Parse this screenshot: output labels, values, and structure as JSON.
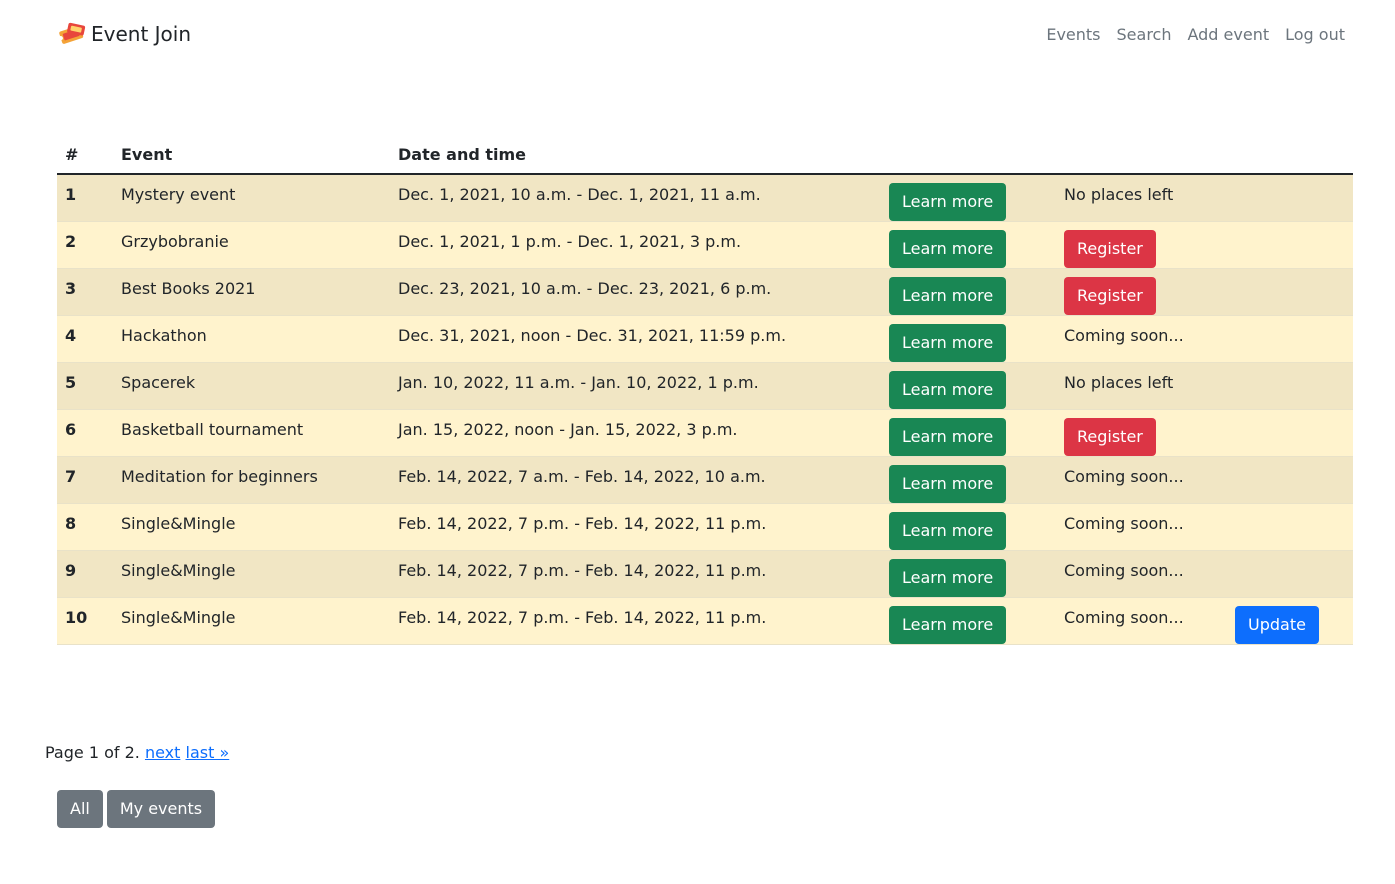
{
  "brand": {
    "name": "Event Join"
  },
  "nav": {
    "items": [
      {
        "label": "Events"
      },
      {
        "label": "Search"
      },
      {
        "label": "Add event"
      },
      {
        "label": "Log out"
      }
    ]
  },
  "table": {
    "headers": {
      "num": "#",
      "event": "Event",
      "date": "Date and time"
    },
    "rows": [
      {
        "num": "1",
        "event": "Mystery event",
        "date": "Dec. 1, 2021, 10 a.m. - Dec. 1, 2021, 11 a.m.",
        "learn": "Learn more",
        "status": "No places left",
        "status_type": "text",
        "extra": ""
      },
      {
        "num": "2",
        "event": "Grzybobranie",
        "date": "Dec. 1, 2021, 1 p.m. - Dec. 1, 2021, 3 p.m.",
        "learn": "Learn more",
        "status": "Register",
        "status_type": "button",
        "extra": ""
      },
      {
        "num": "3",
        "event": "Best Books 2021",
        "date": "Dec. 23, 2021, 10 a.m. - Dec. 23, 2021, 6 p.m.",
        "learn": "Learn more",
        "status": "Register",
        "status_type": "button",
        "extra": ""
      },
      {
        "num": "4",
        "event": "Hackathon",
        "date": "Dec. 31, 2021, noon - Dec. 31, 2021, 11:59 p.m.",
        "learn": "Learn more",
        "status": "Coming soon...",
        "status_type": "text",
        "extra": ""
      },
      {
        "num": "5",
        "event": "Spacerek",
        "date": "Jan. 10, 2022, 11 a.m. - Jan. 10, 2022, 1 p.m.",
        "learn": "Learn more",
        "status": "No places left",
        "status_type": "text",
        "extra": ""
      },
      {
        "num": "6",
        "event": "Basketball tournament",
        "date": "Jan. 15, 2022, noon - Jan. 15, 2022, 3 p.m.",
        "learn": "Learn more",
        "status": "Register",
        "status_type": "button",
        "extra": ""
      },
      {
        "num": "7",
        "event": "Meditation for beginners",
        "date": "Feb. 14, 2022, 7 a.m. - Feb. 14, 2022, 10 a.m.",
        "learn": "Learn more",
        "status": "Coming soon...",
        "status_type": "text",
        "extra": ""
      },
      {
        "num": "8",
        "event": "Single&Mingle",
        "date": "Feb. 14, 2022, 7 p.m. - Feb. 14, 2022, 11 p.m.",
        "learn": "Learn more",
        "status": "Coming soon...",
        "status_type": "text",
        "extra": ""
      },
      {
        "num": "9",
        "event": "Single&Mingle",
        "date": "Feb. 14, 2022, 7 p.m. - Feb. 14, 2022, 11 p.m.",
        "learn": "Learn more",
        "status": "Coming soon...",
        "status_type": "text",
        "extra": ""
      },
      {
        "num": "10",
        "event": "Single&Mingle",
        "date": "Feb. 14, 2022, 7 p.m. - Feb. 14, 2022, 11 p.m.",
        "learn": "Learn more",
        "status": "Coming soon...",
        "status_type": "text",
        "extra": "Update"
      }
    ]
  },
  "pagination": {
    "text": "Page 1 of 2.",
    "next": "next",
    "last": "last »"
  },
  "filters": {
    "all": "All",
    "mine": "My events"
  },
  "colors": {
    "row_odd": "#f1e6c4",
    "row_even": "#fff3cd",
    "success": "#198754",
    "danger": "#dc3545",
    "primary": "#0d6efd",
    "secondary": "#6c757d"
  }
}
